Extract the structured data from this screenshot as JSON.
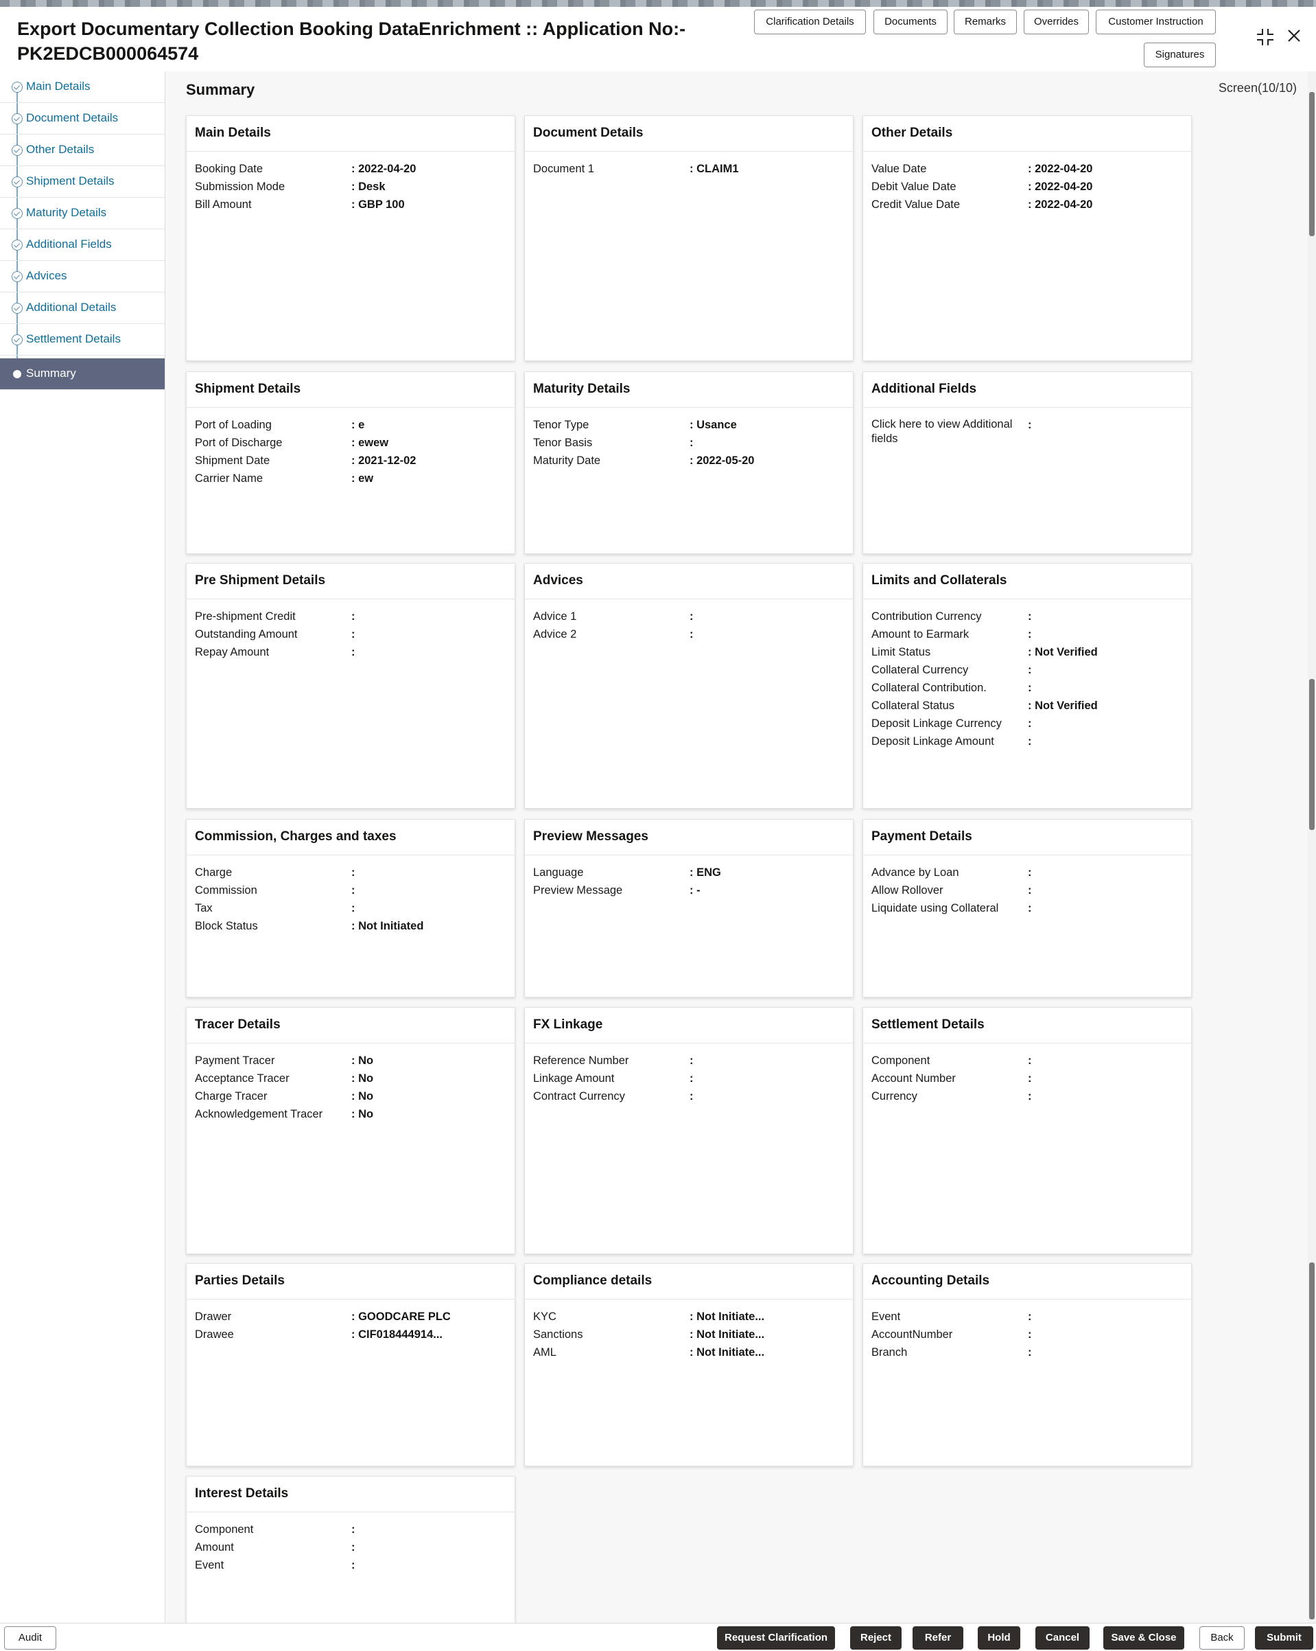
{
  "header": {
    "title": "Export Documentary Collection Booking DataEnrichment :: Application No:- PK2EDCB000064574",
    "buttons": [
      "Clarification Details",
      "Documents",
      "Remarks",
      "Overrides",
      "Customer Instruction",
      "Signatures"
    ],
    "minimize_icon": "collapse-icon",
    "close_icon": "close-icon"
  },
  "sidebar": {
    "items": [
      {
        "label": "Main Details"
      },
      {
        "label": "Document Details"
      },
      {
        "label": "Other Details"
      },
      {
        "label": "Shipment Details"
      },
      {
        "label": "Maturity Details"
      },
      {
        "label": "Additional Fields"
      },
      {
        "label": "Advices"
      },
      {
        "label": "Additional Details"
      },
      {
        "label": "Settlement Details"
      },
      {
        "label": "Summary"
      }
    ]
  },
  "main": {
    "title": "Summary",
    "screen_counter": "Screen(10/10)",
    "cards": [
      {
        "title": "Main Details",
        "rows": [
          [
            "Booking Date",
            ": 2022-04-20"
          ],
          [
            "Submission Mode",
            ": Desk"
          ],
          [
            "Bill Amount",
            ": GBP 100"
          ]
        ]
      },
      {
        "title": "Document Details",
        "rows": [
          [
            "Document 1",
            ": CLAIM1"
          ]
        ]
      },
      {
        "title": "Other Details",
        "rows": [
          [
            "Value Date",
            ": 2022-04-20"
          ],
          [
            "Debit Value Date",
            ": 2022-04-20"
          ],
          [
            "Credit Value Date",
            ": 2022-04-20"
          ]
        ]
      },
      {
        "title": "Shipment Details",
        "rows": [
          [
            "Port of Loading",
            ": e"
          ],
          [
            "Port of Discharge",
            ": ewew"
          ],
          [
            "Shipment Date",
            ": 2021-12-02"
          ],
          [
            "Carrier Name",
            ": ew"
          ]
        ]
      },
      {
        "title": "Maturity Details",
        "rows": [
          [
            "Tenor Type",
            ": Usance"
          ],
          [
            "Tenor Basis",
            ":"
          ],
          [
            "Maturity Date",
            ": 2022-05-20"
          ]
        ]
      },
      {
        "title": "Additional Fields",
        "rows": [
          [
            "Click here to view Additional fields",
            ":"
          ]
        ]
      },
      {
        "title": "Pre Shipment Details",
        "rows": [
          [
            "Pre-shipment Credit",
            ":"
          ],
          [
            "Outstanding Amount",
            ":"
          ],
          [
            "Repay Amount",
            ":"
          ]
        ]
      },
      {
        "title": "Advices",
        "rows": [
          [
            "Advice 1",
            ":"
          ],
          [
            "Advice 2",
            ":"
          ]
        ]
      },
      {
        "title": "Limits and Collaterals",
        "rows": [
          [
            "Contribution Currency",
            ":"
          ],
          [
            "Amount to Earmark",
            ":"
          ],
          [
            "Limit Status",
            ": Not Verified"
          ],
          [
            "Collateral Currency",
            ":"
          ],
          [
            "Collateral Contribution.",
            ":"
          ],
          [
            "Collateral Status",
            ": Not Verified"
          ],
          [
            "Deposit Linkage Currency",
            ":"
          ],
          [
            "Deposit Linkage Amount",
            ":"
          ]
        ]
      },
      {
        "title": "Commission, Charges and taxes",
        "rows": [
          [
            "Charge",
            ":"
          ],
          [
            "Commission",
            ":"
          ],
          [
            "Tax",
            ":"
          ],
          [
            "Block Status",
            ": Not Initiated"
          ]
        ]
      },
      {
        "title": "Preview Messages",
        "rows": [
          [
            "Language",
            ": ENG"
          ],
          [
            "Preview Message",
            ": -"
          ]
        ]
      },
      {
        "title": "Payment Details",
        "rows": [
          [
            "Advance by Loan",
            ":"
          ],
          [
            "Allow Rollover",
            ":"
          ],
          [
            "Liquidate using Collateral",
            ":"
          ]
        ]
      },
      {
        "title": "Tracer Details",
        "rows": [
          [
            "Payment Tracer",
            ": No"
          ],
          [
            "Acceptance Tracer",
            ": No"
          ],
          [
            "Charge Tracer",
            ": No"
          ],
          [
            "Acknowledgement Tracer",
            ": No"
          ]
        ]
      },
      {
        "title": "FX Linkage",
        "rows": [
          [
            "Reference Number",
            ":"
          ],
          [
            "Linkage Amount",
            ":"
          ],
          [
            "Contract Currency",
            ":"
          ]
        ]
      },
      {
        "title": "Settlement Details",
        "rows": [
          [
            "Component",
            ":"
          ],
          [
            "Account Number",
            ":"
          ],
          [
            "Currency",
            ":"
          ]
        ]
      },
      {
        "title": "Parties Details",
        "rows": [
          [
            "Drawer",
            ": GOODCARE PLC"
          ],
          [
            "Drawee",
            ": CIF018444914..."
          ]
        ]
      },
      {
        "title": "Compliance details",
        "rows": [
          [
            "KYC",
            ": Not Initiate..."
          ],
          [
            "Sanctions",
            ": Not Initiate..."
          ],
          [
            "AML",
            ": Not Initiate..."
          ]
        ]
      },
      {
        "title": "Accounting Details",
        "rows": [
          [
            "Event",
            ":"
          ],
          [
            "AccountNumber",
            ":"
          ],
          [
            "Branch",
            ":"
          ]
        ]
      },
      {
        "title": "Interest Details",
        "rows": [
          [
            "Component",
            ":"
          ],
          [
            "Amount",
            ":"
          ],
          [
            "Event",
            ":"
          ]
        ]
      }
    ]
  },
  "footer": {
    "audit": "Audit",
    "buttons": [
      "Request Clarification",
      "Reject",
      "Refer",
      "Hold",
      "Cancel",
      "Save & Close",
      "Back",
      "Submit"
    ]
  }
}
